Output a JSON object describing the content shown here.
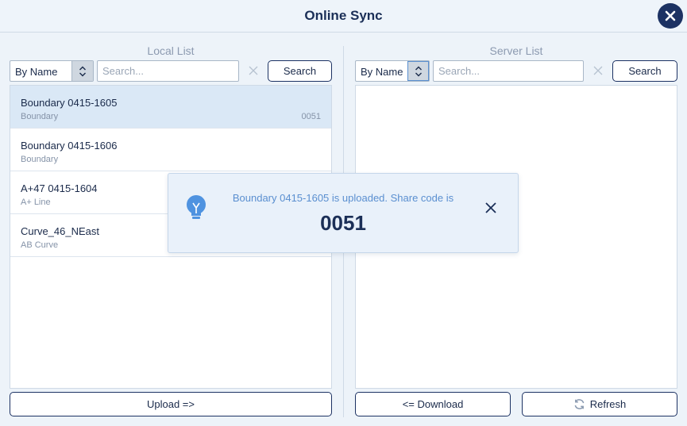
{
  "window": {
    "title": "Online Sync",
    "close_icon": "close-icon"
  },
  "local": {
    "label": "Local List",
    "sort_value": "By Name",
    "search_placeholder": "Search...",
    "search_button": "Search",
    "items": [
      {
        "name": "Boundary 0415-1605",
        "type": "Boundary",
        "code": "0051",
        "selected": true
      },
      {
        "name": "Boundary 0415-1606",
        "type": "Boundary",
        "code": ""
      },
      {
        "name": "A+47 0415-1604",
        "type": "A+ Line",
        "code": ""
      },
      {
        "name": "Curve_46_NEast",
        "type": "AB Curve",
        "code": ""
      }
    ],
    "upload_button": "Upload =>"
  },
  "server": {
    "label": "Server List",
    "sort_value": "By Name",
    "search_placeholder": "Search...",
    "search_button": "Search",
    "download_button": "<= Download",
    "refresh_button": "Refresh"
  },
  "toast": {
    "message": "Boundary 0415-1605 is uploaded. Share code is",
    "code": "0051",
    "icon": "lightbulb-icon"
  },
  "colors": {
    "accent": "#1c3263",
    "highlight": "#5a8fd0",
    "selected_row": "#dae8f6",
    "background": "#edf3f9"
  }
}
